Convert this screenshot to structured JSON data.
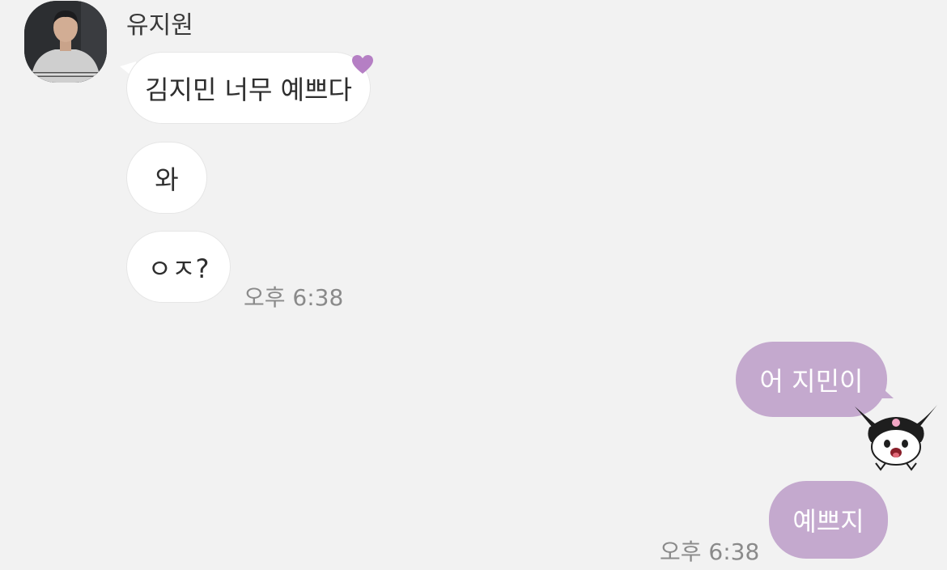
{
  "chat": {
    "sender_name": "유지원",
    "incoming": [
      {
        "text": "김지민 너무 예쁘다",
        "reaction": "heart-icon"
      },
      {
        "text": "와"
      },
      {
        "text": "ㅇㅈ?"
      }
    ],
    "incoming_time": "오후 6:38",
    "outgoing": [
      {
        "text": "어 지민이"
      },
      {
        "text": "예쁘지"
      }
    ],
    "outgoing_time": "오후 6:38"
  },
  "colors": {
    "background": "#f2f2f2",
    "incoming_bubble": "#ffffff",
    "outgoing_bubble": "#c4a9ce",
    "reaction_heart": "#b57fc4",
    "timestamp": "#8a8a8a"
  }
}
